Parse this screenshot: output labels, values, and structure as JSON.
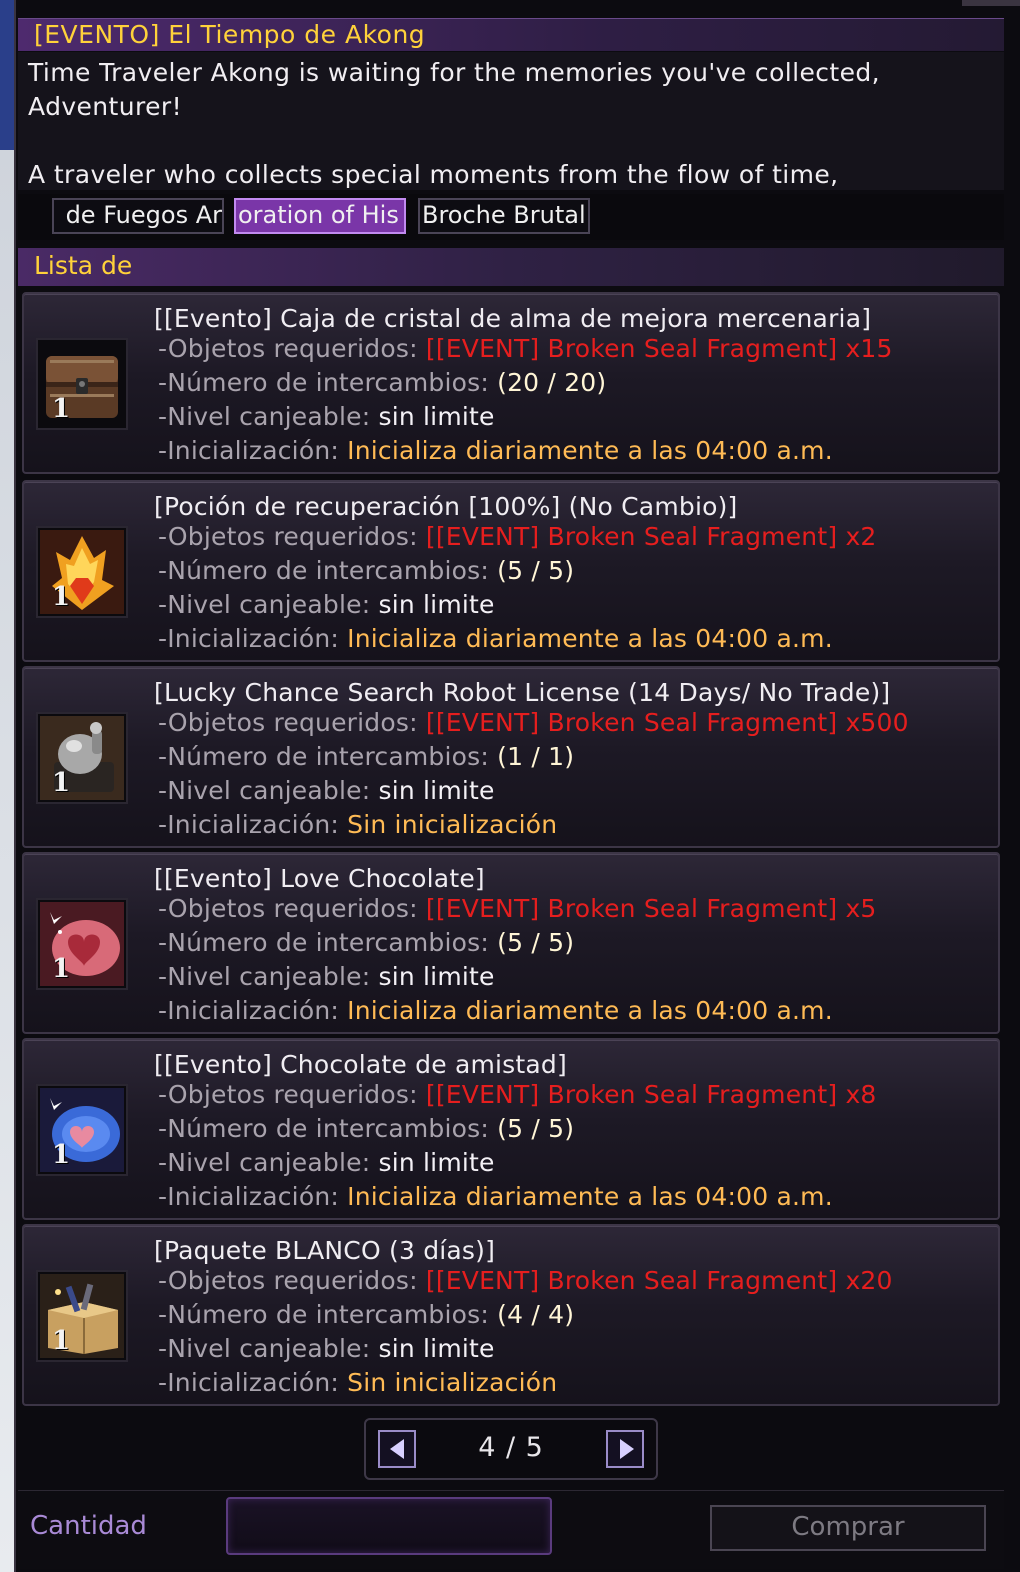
{
  "window": {
    "title": "[EVENTO] El Tiempo de Akong"
  },
  "description": {
    "line1": "Time Traveler Akong is waiting for the memories you've collected,",
    "line2": "Adventurer!",
    "line3": "A traveler who collects special moments from the flow of time,"
  },
  "tabs": [
    {
      "label": "de Fuegos Ar",
      "active": false
    },
    {
      "label": "oration of His",
      "active": true
    },
    {
      "label": "Broche Brutal",
      "active": false
    }
  ],
  "list": {
    "header": "Lista de",
    "labels": {
      "required": "-Objetos requeridos:",
      "exchanges": "-Número de intercambios:",
      "level": "-Nivel canjeable:",
      "reset": "-Inicialización:"
    },
    "items": [
      {
        "name": "[[Evento] Caja de cristal de alma de mejora mercenaria]",
        "icon": "treasure-chest-icon",
        "qty": "1",
        "required": "[[EVENT] Broken Seal Fragment] x15",
        "exchanges": "(20 / 20)",
        "level": "sin limite",
        "reset": "Inicializa diariamente a las 04:00 a.m."
      },
      {
        "name": "[Poción de recuperación [100%] (No Cambio)]",
        "icon": "fire-crystal-icon",
        "qty": "1",
        "required": "[[EVENT] Broken Seal Fragment] x2",
        "exchanges": "(5 / 5)",
        "level": "sin limite",
        "reset": "Inicializa diariamente a las 04:00 a.m."
      },
      {
        "name": "[Lucky Chance Search Robot License (14 Days/ No Trade)]",
        "icon": "robot-license-icon",
        "qty": "1",
        "required": "[[EVENT] Broken Seal Fragment] x500",
        "exchanges": "(1 / 1)",
        "level": "sin limite",
        "reset": "Sin inicialización"
      },
      {
        "name": "[[Evento] Love Chocolate]",
        "icon": "love-chocolate-icon",
        "qty": "1",
        "required": "[[EVENT] Broken Seal Fragment] x5",
        "exchanges": "(5 / 5)",
        "level": "sin limite",
        "reset": "Inicializa diariamente a las 04:00 a.m."
      },
      {
        "name": "[[Evento] Chocolate de amistad]",
        "icon": "friendship-chocolate-icon",
        "qty": "1",
        "required": "[[EVENT] Broken Seal Fragment] x8",
        "exchanges": "(5 / 5)",
        "level": "sin limite",
        "reset": "Inicializa diariamente a las 04:00 a.m."
      },
      {
        "name": "[Paquete BLANCO (3 días)]",
        "icon": "white-package-icon",
        "qty": "1",
        "required": "[[EVENT] Broken Seal Fragment] x20",
        "exchanges": "(4 / 4)",
        "level": "sin limite",
        "reset": "Sin inicialización"
      }
    ]
  },
  "pager": {
    "text": "4 / 5"
  },
  "bottom": {
    "quantity_label": "Cantidad",
    "quantity_value": "",
    "buy_label": "Comprar"
  },
  "colors": {
    "title": "#ffd23a",
    "required": "#e61e1e",
    "reset": "#ffbb55",
    "accent": "#7a36a8"
  }
}
